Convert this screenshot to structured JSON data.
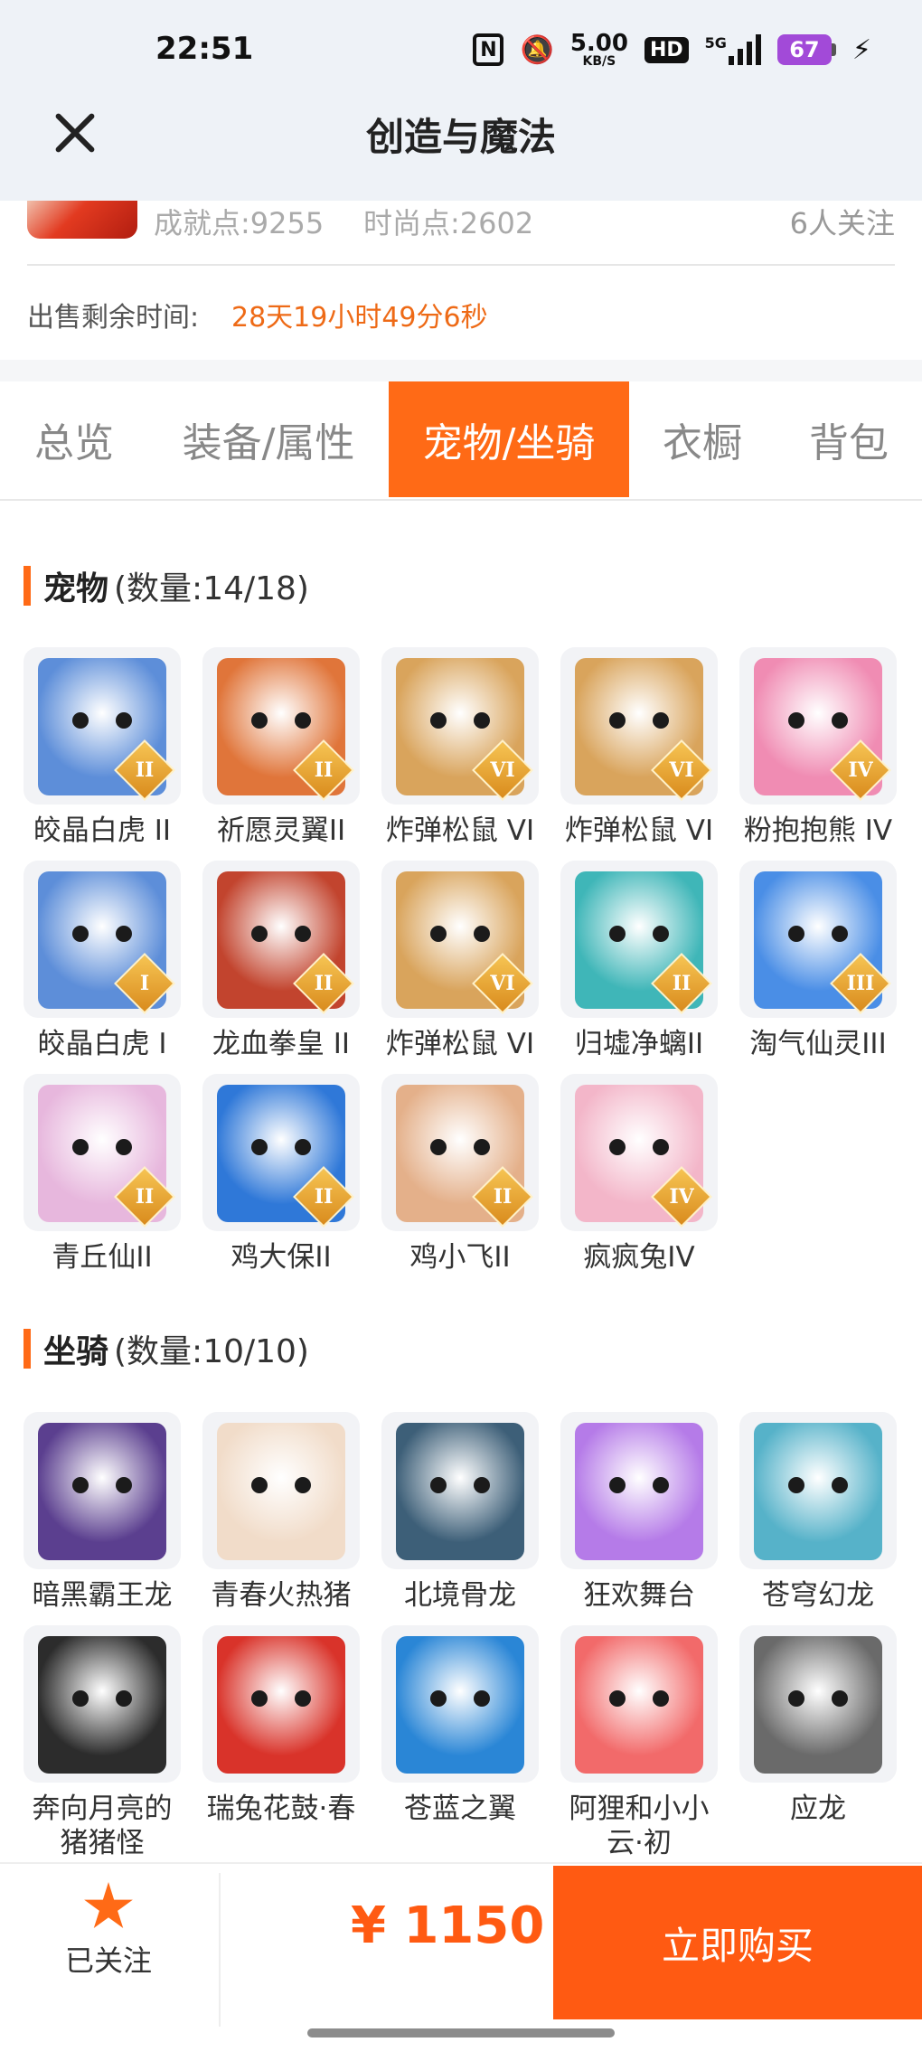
{
  "status_bar": {
    "time": "22:51",
    "net_speed": "5.00",
    "net_unit": "KB/S",
    "hd": "HD",
    "network": "5G",
    "battery": "67"
  },
  "header": {
    "title": "创造与魔法"
  },
  "profile": {
    "achievement": "成就点:9255",
    "fashion": "时尚点:2602",
    "followers": "6人关注",
    "sale_label": "出售剩余时间:",
    "sale_remaining": "28天19小时49分6秒"
  },
  "tabs": [
    {
      "label": "总览"
    },
    {
      "label": "装备/属性"
    },
    {
      "label": "宠物/坐骑"
    },
    {
      "label": "衣橱"
    },
    {
      "label": "背包"
    }
  ],
  "pets": {
    "title": "宠物",
    "count": "(数量:14/18)",
    "items": [
      {
        "name": "皎晶白虎 II",
        "tier": "II",
        "icon": "white-tiger-icon",
        "color": "#5d8ed9"
      },
      {
        "name": "祈愿灵翼II",
        "tier": "II",
        "icon": "spirit-bird-icon",
        "color": "#e0753a"
      },
      {
        "name": "炸弹松鼠 VI",
        "tier": "VI",
        "icon": "bomb-squirrel-icon",
        "color": "#d9a45c"
      },
      {
        "name": "炸弹松鼠 VI",
        "tier": "VI",
        "icon": "bomb-squirrel-icon",
        "color": "#d9a45c"
      },
      {
        "name": "粉抱抱熊 IV",
        "tier": "IV",
        "icon": "pink-bear-icon",
        "color": "#f08cb3"
      },
      {
        "name": "皎晶白虎 I",
        "tier": "I",
        "icon": "white-tiger-icon",
        "color": "#5d8ed9"
      },
      {
        "name": "龙血拳皇 II",
        "tier": "II",
        "icon": "dragon-fighter-icon",
        "color": "#c2442e"
      },
      {
        "name": "炸弹松鼠 VI",
        "tier": "VI",
        "icon": "bomb-squirrel-icon",
        "color": "#d9a45c"
      },
      {
        "name": "归墟净螭II",
        "tier": "II",
        "icon": "water-dragon-icon",
        "color": "#3fb6b8"
      },
      {
        "name": "淘气仙灵III",
        "tier": "III",
        "icon": "blue-puppy-icon",
        "color": "#4a8ee6"
      },
      {
        "name": "青丘仙II",
        "tier": "II",
        "icon": "fox-fairy-icon",
        "color": "#e7b7dd"
      },
      {
        "name": "鸡大保II",
        "tier": "II",
        "icon": "blue-chicken-icon",
        "color": "#2f78d8"
      },
      {
        "name": "鸡小飞II",
        "tier": "II",
        "icon": "muscle-chick-icon",
        "color": "#e4b08a"
      },
      {
        "name": "疯疯兔IV",
        "tier": "IV",
        "icon": "crazy-rabbit-icon",
        "color": "#f3b6c9"
      }
    ]
  },
  "mounts": {
    "title": "坐骑",
    "count": "(数量:10/10)",
    "items": [
      {
        "name": "暗黑霸王龙",
        "icon": "dark-trex-icon",
        "color": "#5b3f8f"
      },
      {
        "name": "青春火热猪",
        "icon": "fire-pig-icon",
        "color": "#f1dcc9"
      },
      {
        "name": "北境骨龙",
        "icon": "bone-dragon-icon",
        "color": "#3d5f78"
      },
      {
        "name": "狂欢舞台",
        "icon": "carnival-stage-icon",
        "color": "#b57be8"
      },
      {
        "name": "苍穹幻龙",
        "icon": "sky-dragon-icon",
        "color": "#56b2c9"
      },
      {
        "name": "奔向月亮的猪猪怪",
        "icon": "moon-pig-icon",
        "color": "#2c2c2c"
      },
      {
        "name": "瑞兔花鼓·春",
        "icon": "rabbit-drum-icon",
        "color": "#d9332a"
      },
      {
        "name": "苍蓝之翼",
        "icon": "azure-wing-icon",
        "color": "#2a86d6"
      },
      {
        "name": "阿狸和小小云·初",
        "icon": "ali-cloud-icon",
        "color": "#f26a6a"
      },
      {
        "name": "应龙",
        "icon": "ying-dragon-icon",
        "color": "#6a6a6a"
      }
    ]
  },
  "bottom_bar": {
    "follow_label": "已关注",
    "price": "¥ 1150",
    "buy_label": "立即购买"
  }
}
